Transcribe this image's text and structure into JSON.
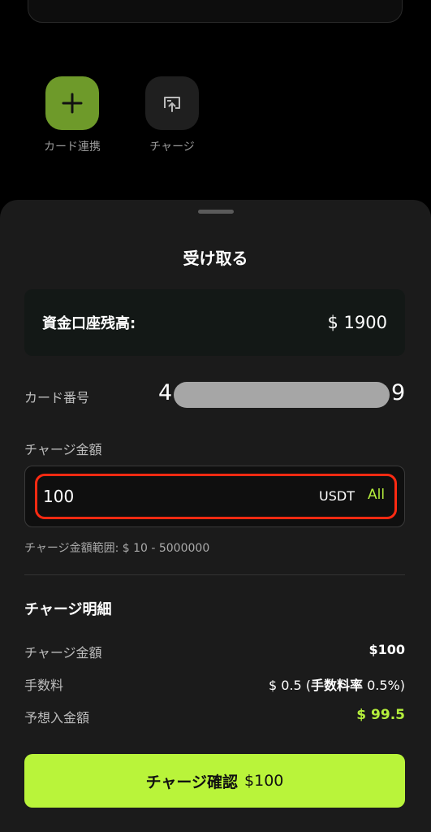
{
  "background": {
    "actions": [
      {
        "label": "カード連携",
        "icon": "plus-icon"
      },
      {
        "label": "チャージ",
        "icon": "charge-icon"
      }
    ]
  },
  "sheet": {
    "title": "受け取る",
    "balance": {
      "label": "資金口座残高:",
      "value": "$ 1900"
    },
    "card": {
      "label": "カード番号",
      "first_digit": "4",
      "last_digit": "9"
    },
    "amount": {
      "label": "チャージ金額",
      "value": "100",
      "unit": "USDT",
      "all_label": "All",
      "range": "チャージ金額範囲: $ 10 - 5000000"
    },
    "details": {
      "title": "チャージ明細",
      "rows": [
        {
          "label": "チャージ金額",
          "value": "$100"
        },
        {
          "label": "手数料",
          "value": "$ 0.5 (",
          "rate": "手数料率",
          "rate_value": " 0.5%)"
        },
        {
          "label": "予想入金額",
          "value": "$ 99.5"
        }
      ]
    },
    "confirm": {
      "label": "チャージ確認",
      "amount": "$100"
    }
  },
  "colors": {
    "accent": "#b9f43a",
    "highlight": "#ff2a12",
    "add_button": "#6e9a2a"
  }
}
